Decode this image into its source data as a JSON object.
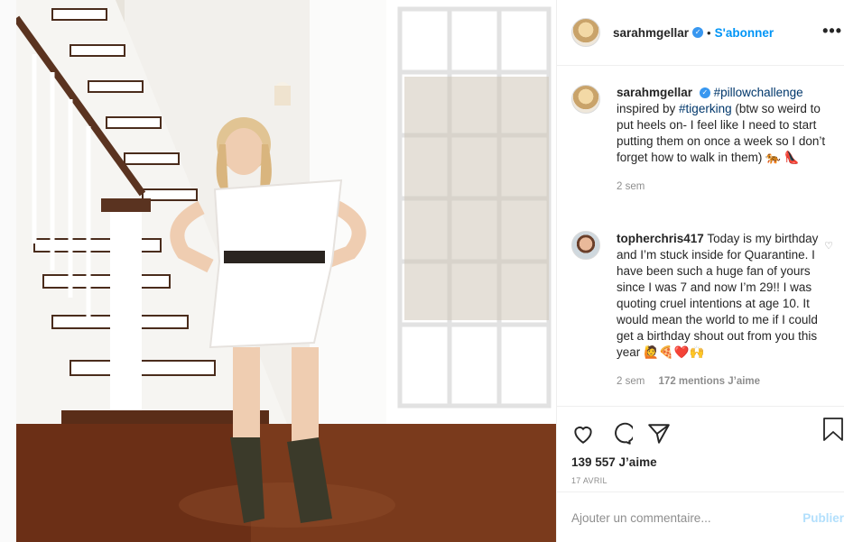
{
  "post": {
    "author": "sarahmgellar",
    "follow_label": "S'abonner",
    "separator": "•",
    "more_label": "•••"
  },
  "caption": {
    "author": "sarahmgellar",
    "hashtag1": "#pillowchallenge",
    "text_a": "inspired by ",
    "hashtag2": "#tigerking",
    "text_b": " (btw so weird to put heels on- I feel like I need to start putting them on once a week so I don’t forget how to walk in them) 🐅 👠",
    "time": "2 sem"
  },
  "comment2": {
    "author": "topherchris417",
    "text": "Today is my birthday and I’m stuck inside for Quarantine. I have been such a huge fan of yours since I was 7 and now I’m 29!! I was quoting cruel intentions at age 10. It would mean the world to me if I could get a birthday shout out from you this year 🙋🍕❤️🙌",
    "time": "2 sem",
    "likes": "172 mentions J’aime"
  },
  "stats": {
    "likes": "139 557 J’aime",
    "date": "17 AVRIL"
  },
  "add_comment": {
    "placeholder": "Ajouter un commentaire...",
    "post_label": "Publier"
  },
  "icons": [
    "verified-badge",
    "heart-icon",
    "comment-icon",
    "share-icon",
    "bookmark-icon",
    "small-heart-icon"
  ],
  "colors": {
    "link": "#0095f6",
    "hashtag": "#00376b",
    "muted": "#8e8e8e"
  }
}
